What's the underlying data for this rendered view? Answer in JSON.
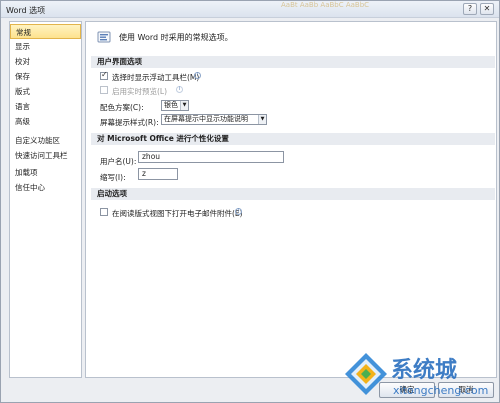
{
  "window": {
    "title": "Word 选项",
    "background_ribbon_text": "AaBt  AaBb  AaBbC  AaBbC"
  },
  "titlebar": {
    "help_label": "?",
    "close_label": "✕"
  },
  "sidebar": {
    "items": [
      {
        "label": "常规",
        "active": true
      },
      {
        "label": "显示"
      },
      {
        "label": "校对"
      },
      {
        "label": "保存"
      },
      {
        "label": "版式"
      },
      {
        "label": "语言"
      },
      {
        "label": "高级"
      },
      {
        "label": "自定义功能区"
      },
      {
        "label": "快速访问工具栏"
      },
      {
        "label": "加载项"
      },
      {
        "label": "信任中心"
      }
    ]
  },
  "main": {
    "intro": "使用 Word 时采用的常规选项。",
    "ui_section": {
      "heading": "用户界面选项",
      "mini_toolbar_label": "选择时显示浮动工具栏(M)",
      "mini_toolbar_checked": true,
      "live_preview_label": "启用实时预览(L)",
      "live_preview_checked": false,
      "color_scheme_label": "配色方案(C):",
      "color_scheme_value": "银色",
      "screentip_label": "屏幕提示样式(R):",
      "screentip_value": "在屏幕提示中显示功能说明"
    },
    "personalize_section": {
      "heading": "对 Microsoft Office 进行个性化设置",
      "username_label": "用户名(U):",
      "username_value": "zhou",
      "initials_label": "缩写(I):",
      "initials_value": "z"
    },
    "startup_section": {
      "heading": "启动选项",
      "reading_view_label": "在阅读版式视图下打开电子邮件附件(E)",
      "reading_view_checked": false
    }
  },
  "footer": {
    "ok_label": "确定",
    "cancel_label": "取消"
  },
  "watermark": {
    "text": "系统城",
    "url": "xitongcheng.com"
  },
  "colors": {
    "active_nav": "#fde28e",
    "section_bg": "#e8ebf0",
    "watermark": "#2a6fbf"
  }
}
